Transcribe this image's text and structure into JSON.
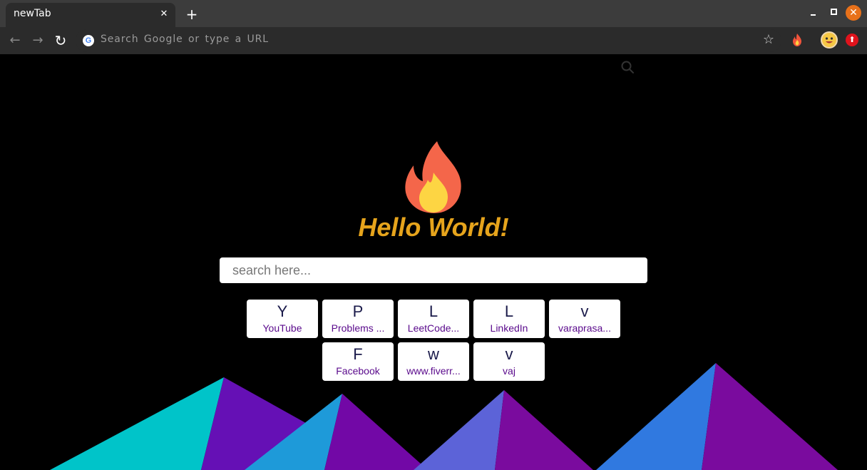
{
  "window": {
    "tab_title": "newTab",
    "close_tab_glyph": "✕",
    "new_tab_glyph": "+",
    "close_window_glyph": "✕"
  },
  "toolbar": {
    "back_glyph": "←",
    "forward_glyph": "→",
    "reload_glyph": "↻",
    "omnibox_placeholder": "Search Google or type a URL",
    "bookmark_glyph": "☆",
    "extension_upload_glyph": "⬆"
  },
  "page": {
    "heading": "Hello World!",
    "search_placeholder": "search here...",
    "heading_color": "#e6a41c"
  },
  "shortcuts": [
    {
      "letter": "Y",
      "label": "YouTube"
    },
    {
      "letter": "P",
      "label": "Problems ..."
    },
    {
      "letter": "L",
      "label": "LeetCode..."
    },
    {
      "letter": "L",
      "label": "LinkedIn"
    },
    {
      "letter": "v",
      "label": "varaprasa..."
    },
    {
      "letter": "F",
      "label": "Facebook"
    },
    {
      "letter": "w",
      "label": "www.fiverr..."
    },
    {
      "letter": "v",
      "label": "vaj"
    }
  ]
}
